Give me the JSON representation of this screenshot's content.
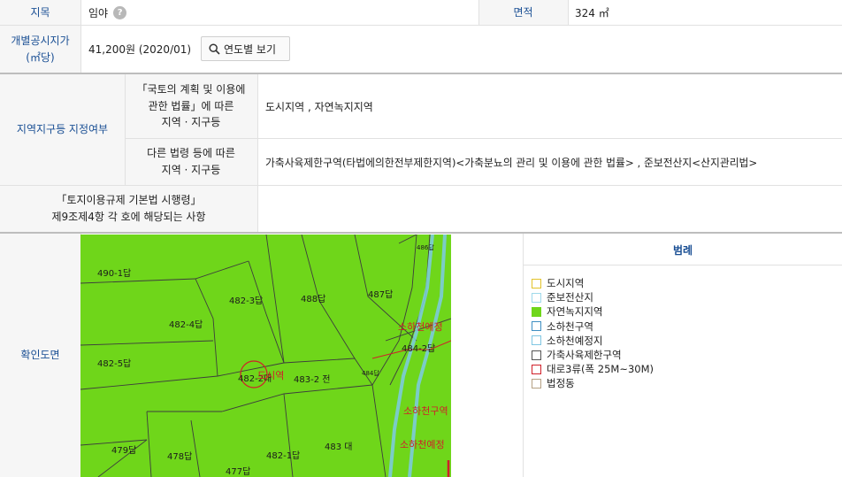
{
  "rows": {
    "jimok_label": "지목",
    "jimok_value": "임야",
    "help_glyph": "?",
    "area_label": "면적",
    "area_value": "324 ㎡",
    "price_label": "개별공시지가\n(㎡당)",
    "price_value": "41,200원 (2020/01)",
    "price_button": "연도별 보기",
    "zone_label": "지역지구등 지정여부",
    "zone_law_label": "「국토의 계획 및 이용에\n관한 법률」에 따른\n지역 · 지구등",
    "zone_law_value": "도시지역 , 자연녹지지역",
    "zone_other_label": "다른 법령 등에 따른\n지역 · 지구등",
    "zone_other_value": "가축사육제한구역(타법에의한전부제한지역)<가축분뇨의 관리 및 이용에 관한 법률> , 준보전산지<산지관리법>",
    "rule_label": "「토지이용규제 기본법 시행령」\n제9조제4항 각 호에 해당되는 사항",
    "rule_value": "",
    "map_label": "확인도면"
  },
  "map": {
    "parcels": [
      "490-1답",
      "482-3답",
      "488답",
      "487답",
      "482-4답",
      "482-5답",
      "482-2대",
      "483-2 전",
      "484-2답",
      "483 대",
      "482-1답",
      "479답",
      "478답",
      "477답",
      "486답",
      "484답"
    ],
    "overlay_texts": [
      "소하천예정",
      "소하천구역",
      "소하천예정",
      "도시역"
    ]
  },
  "legend": {
    "title": "범례",
    "items": [
      {
        "label": "도시지역",
        "color": "#e2c32a",
        "fill": "#ffffff"
      },
      {
        "label": "준보전산지",
        "color": "#9fd9ea",
        "fill": "#ffffff"
      },
      {
        "label": "자연녹지지역",
        "color": "#6fd61a",
        "fill": "#6fd61a"
      },
      {
        "label": "소하천구역",
        "color": "#3f8fc2",
        "fill": "#ffffff"
      },
      {
        "label": "소하천예정지",
        "color": "#7fc6e2",
        "fill": "#ffffff"
      },
      {
        "label": "가축사육제한구역",
        "color": "#555555",
        "fill": "#ffffff"
      },
      {
        "label": "대로3류(폭 25M~30M)",
        "color": "#d0202a",
        "fill": "#ffffff"
      },
      {
        "label": "법정동",
        "color": "#b5a184",
        "fill": "#ffffff"
      }
    ]
  }
}
